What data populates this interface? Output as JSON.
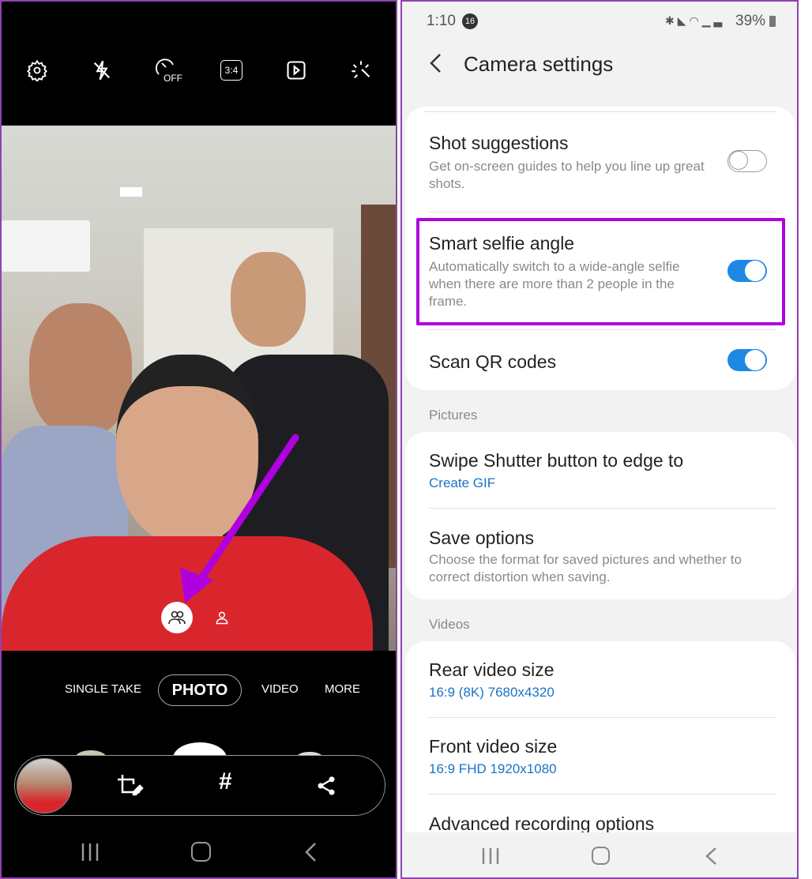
{
  "camera": {
    "top_icons": [
      "settings-icon",
      "flash-off-icon",
      "timer-off-icon",
      "aspect-ratio-icon",
      "motion-photo-icon",
      "filter-effects-icon"
    ],
    "timer_label": "OFF",
    "ratio_label": "3:4",
    "modes": [
      "SINGLE TAKE",
      "PHOTO",
      "VIDEO",
      "MORE"
    ],
    "active_mode": "PHOTO",
    "toolbar_icons": [
      "gallery-thumbnail",
      "crop-edit-icon",
      "hashtag-icon",
      "share-icon"
    ],
    "hashtag": "#",
    "selfie_angle_options": [
      "wide-selfie-icon",
      "normal-selfie-icon"
    ],
    "accent": "#b000e0"
  },
  "settings": {
    "status": {
      "time": "1:10",
      "notif_count": "16",
      "battery": "39%"
    },
    "title": "Camera settings",
    "items": [
      {
        "title": "Shot suggestions",
        "subtitle": "Get on-screen guides to help you line up great shots.",
        "toggle": false
      },
      {
        "title": "Smart selfie angle",
        "subtitle": "Automatically switch to a wide-angle selfie when there are more than 2 people in the frame.",
        "toggle": true,
        "highlighted": true
      },
      {
        "title": "Scan QR codes",
        "toggle": true
      }
    ],
    "pictures_header": "Pictures",
    "pictures": [
      {
        "title": "Swipe Shutter button to edge to",
        "value": "Create GIF"
      },
      {
        "title": "Save options",
        "subtitle": "Choose the format for saved pictures and whether to correct distortion when saving."
      }
    ],
    "videos_header": "Videos",
    "videos": [
      {
        "title": "Rear video size",
        "value": "16:9 (8K) 7680x4320"
      },
      {
        "title": "Front video size",
        "value": "16:9 FHD 1920x1080"
      },
      {
        "title": "Advanced recording options"
      }
    ],
    "toggle_on_color": "#1e88e5",
    "highlight_color": "#b000e0"
  }
}
